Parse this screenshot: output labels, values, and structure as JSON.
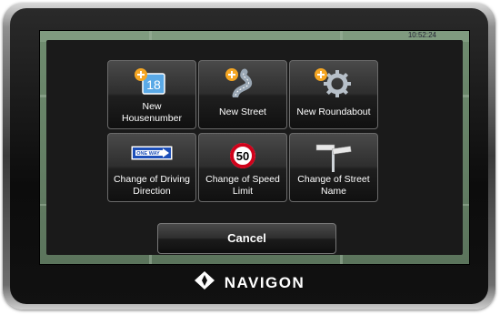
{
  "screen": {
    "clock": "10:52:24"
  },
  "menu": {
    "tiles": [
      {
        "label_line1": "New",
        "label_line2": "Housenumber",
        "icon": "add-housenumber-icon",
        "badge_number": "18"
      },
      {
        "label": "New Street",
        "icon": "add-street-icon"
      },
      {
        "label": "New Roundabout",
        "icon": "add-roundabout-icon"
      },
      {
        "label_line1": "Change of Driving",
        "label_line2": "Direction",
        "icon": "one-way-sign-icon",
        "sign_text": "ONE WAY"
      },
      {
        "label_line1": "Change of Speed",
        "label_line2": "Limit",
        "icon": "speed-limit-sign-icon",
        "sign_text": "50"
      },
      {
        "label_line1": "Change of Street",
        "label_line2": "Name",
        "icon": "street-name-sign-icon"
      }
    ],
    "cancel_label": "Cancel"
  },
  "brand": {
    "name": "NAVIGON",
    "logo_icon": "navigon-diamond-icon"
  },
  "colors": {
    "plus_badge": "#f5a623",
    "tile_text": "#ffffff",
    "speed_sign_ring": "#d0021b"
  }
}
